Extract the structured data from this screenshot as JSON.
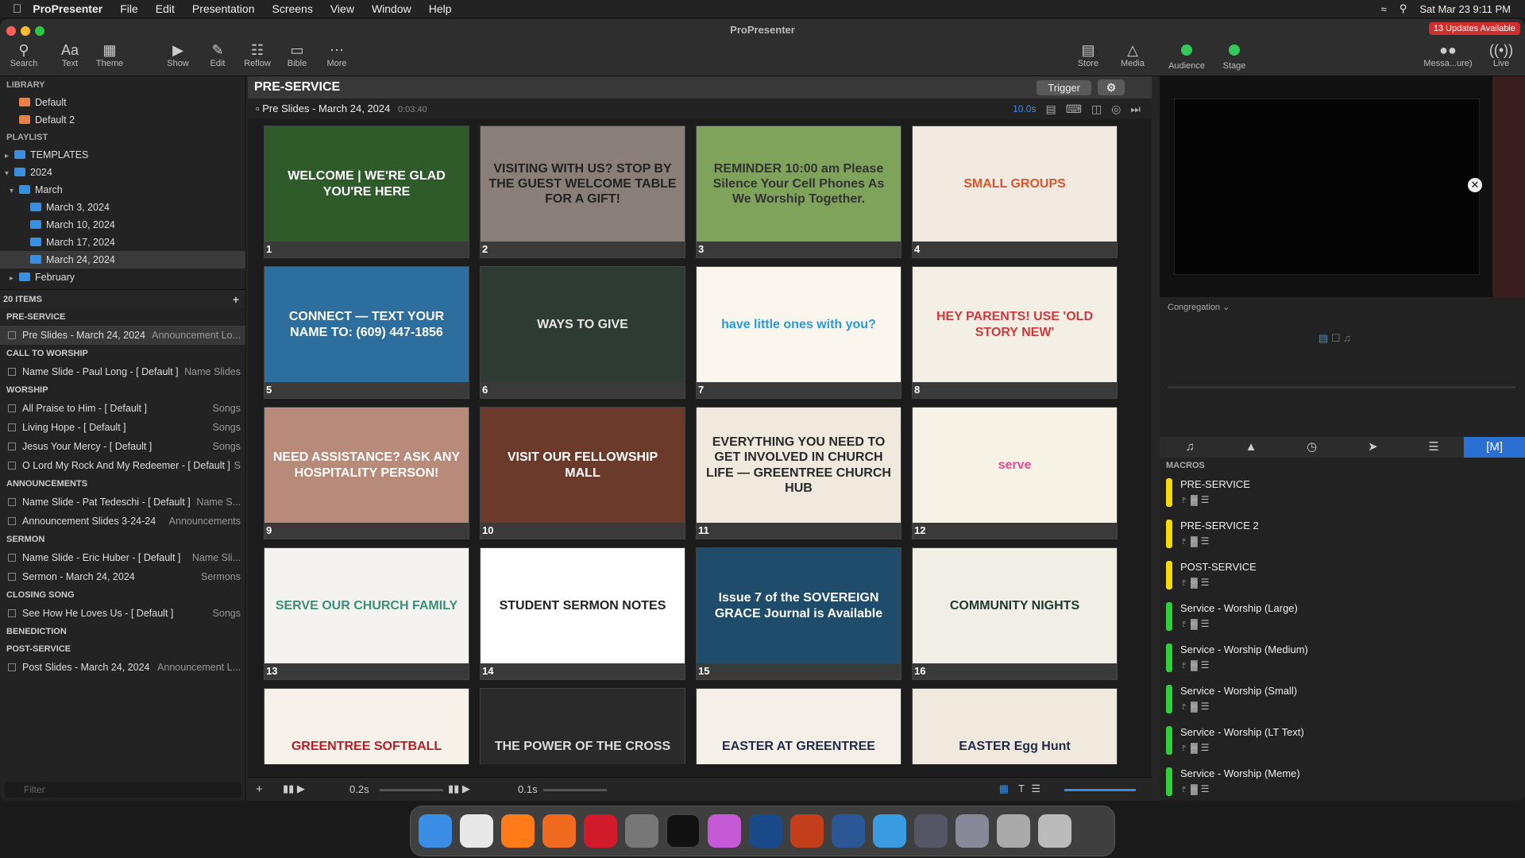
{
  "menubar": {
    "app": "ProPresenter",
    "items": [
      "File",
      "Edit",
      "Presentation",
      "Screens",
      "View",
      "Window",
      "Help"
    ],
    "clock": "Sat Mar 23  9:11 PM"
  },
  "window": {
    "title": "ProPresenter",
    "updates": "13 Updates Available"
  },
  "toolbar": {
    "search": "Search",
    "text": "Text",
    "theme": "Theme",
    "show": "Show",
    "edit": "Edit",
    "reflow": "Reflow",
    "bible": "Bible",
    "more": "More",
    "store": "Store",
    "media": "Media",
    "audience": "Audience",
    "stage": "Stage",
    "messages": "Messa...ure)",
    "live": "Live"
  },
  "library": {
    "heading": "LIBRARY",
    "items": [
      "Default",
      "Default 2"
    ],
    "playlist_heading": "PLAYLIST",
    "tree": [
      "TEMPLATES",
      "2024",
      "March",
      "March 3, 2024",
      "March 10, 2024",
      "March 17, 2024",
      "March 24, 2024",
      "February"
    ]
  },
  "playlist": {
    "count": "20 ITEMS",
    "rows": [
      {
        "kind": "header",
        "name": "PRE-SERVICE"
      },
      {
        "kind": "item",
        "name": "Pre Slides - March 24, 2024",
        "type": "Announcement Lo..."
      },
      {
        "kind": "header",
        "name": "CALL TO WORSHIP"
      },
      {
        "kind": "item",
        "name": "Name Slide - Paul Long - [ Default ]",
        "type": "Name Slides"
      },
      {
        "kind": "header",
        "name": "WORSHIP"
      },
      {
        "kind": "item",
        "name": "All Praise to Him - [ Default ]",
        "type": "Songs"
      },
      {
        "kind": "item",
        "name": "Living Hope - [ Default ]",
        "type": "Songs"
      },
      {
        "kind": "item",
        "name": "Jesus Your Mercy - [ Default ]",
        "type": "Songs"
      },
      {
        "kind": "item",
        "name": "O Lord My Rock And My Redeemer - [ Default ]",
        "type": "S"
      },
      {
        "kind": "header",
        "name": "ANNOUNCEMENTS"
      },
      {
        "kind": "item",
        "name": "Name Slide - Pat Tedeschi - [ Default ]",
        "type": "Name S..."
      },
      {
        "kind": "item",
        "name": "Announcement Slides 3-24-24",
        "type": "Announcements"
      },
      {
        "kind": "header",
        "name": "SERMON"
      },
      {
        "kind": "item",
        "name": "Name Slide - Eric Huber - [ Default ]",
        "type": "Name Sli..."
      },
      {
        "kind": "item",
        "name": "Sermon - March 24, 2024",
        "type": "Sermons"
      },
      {
        "kind": "header",
        "name": "CLOSING SONG"
      },
      {
        "kind": "item",
        "name": "See How He Loves Us - [ Default ]",
        "type": "Songs"
      },
      {
        "kind": "header",
        "name": "BENEDICTION"
      },
      {
        "kind": "header",
        "name": "POST-SERVICE"
      },
      {
        "kind": "item",
        "name": "Post Slides - March 24, 2024",
        "type": "Announcement L..."
      }
    ],
    "filter_placeholder": "Filter"
  },
  "presentation": {
    "header": "PRE-SERVICE",
    "trigger": "Trigger",
    "title": "Pre Slides - March 24, 2024",
    "duration": "0:03:40",
    "timer": "10.0s",
    "slides": [
      {
        "num": "1",
        "text": "WELCOME | WE'RE GLAD YOU'RE HERE",
        "bg": "#2f5a2a",
        "fg": "#ffffff"
      },
      {
        "num": "2",
        "text": "VISITING WITH US? STOP BY THE GUEST WELCOME TABLE FOR A GIFT!",
        "bg": "#8a7f78",
        "fg": "#222222"
      },
      {
        "num": "3",
        "text": "REMINDER 10:00 am Please Silence Your Cell Phones As We Worship Together.",
        "bg": "#7fa35b",
        "fg": "#333333"
      },
      {
        "num": "4",
        "text": "SMALL GROUPS",
        "bg": "#f2e9e0",
        "fg": "#d9572b"
      },
      {
        "num": "5",
        "text": "CONNECT — TEXT YOUR NAME TO: (609) 447-1856",
        "bg": "#2c6f9e",
        "fg": "#ffffff"
      },
      {
        "num": "6",
        "text": "WAYS TO GIVE",
        "bg": "#2e3a34",
        "fg": "#e6e6e6"
      },
      {
        "num": "7",
        "text": "have little ones with you?",
        "bg": "#faf6ee",
        "fg": "#2a9bd6"
      },
      {
        "num": "8",
        "text": "HEY PARENTS! USE 'OLD STORY NEW'",
        "bg": "#f4efe4",
        "fg": "#d1393f"
      },
      {
        "num": "9",
        "text": "NEED ASSISTANCE? ASK ANY HOSPITALITY PERSON!",
        "bg": "#b88a7a",
        "fg": "#ffffff"
      },
      {
        "num": "10",
        "text": "VISIT OUR FELLOWSHIP MALL",
        "bg": "#6b3a2a",
        "fg": "#ffffff"
      },
      {
        "num": "11",
        "text": "EVERYTHING YOU NEED TO GET INVOLVED IN CHURCH LIFE — GREENTREE CHURCH HUB",
        "bg": "#efe9de",
        "fg": "#2a2a2a"
      },
      {
        "num": "12",
        "text": "serve",
        "bg": "#f7f2e6",
        "fg": "#e84a8f"
      },
      {
        "num": "13",
        "text": "SERVE OUR CHURCH FAMILY",
        "bg": "#f5f3ef",
        "fg": "#3b8f77"
      },
      {
        "num": "14",
        "text": "STUDENT SERMON NOTES",
        "bg": "#ffffff",
        "fg": "#222222"
      },
      {
        "num": "15",
        "text": "Issue 7 of the SOVEREIGN GRACE Journal is Available",
        "bg": "#1f4c6b",
        "fg": "#ffffff"
      },
      {
        "num": "16",
        "text": "COMMUNITY NIGHTS",
        "bg": "#f1eee6",
        "fg": "#1f3a2e"
      },
      {
        "num": "",
        "text": "GREENTREE SOFTBALL",
        "bg": "#f6f2ea",
        "fg": "#b3202a"
      },
      {
        "num": "",
        "text": "THE POWER OF THE CROSS",
        "bg": "#2a2a2a",
        "fg": "#dddddd"
      },
      {
        "num": "",
        "text": "EASTER AT GREENTREE",
        "bg": "#f4f0e8",
        "fg": "#1f2a4a"
      },
      {
        "num": "",
        "text": "EASTER Egg Hunt",
        "bg": "#f0e9dd",
        "fg": "#1f2a4a"
      }
    ],
    "footer": {
      "transition1": "0.2s",
      "transition2": "0.1s"
    }
  },
  "rightpanel": {
    "screen": "Congregation",
    "macros_heading": "MACROS",
    "macros": [
      {
        "name": "PRE-SERVICE",
        "color": "#f5d90a"
      },
      {
        "name": "PRE-SERVICE 2",
        "color": "#f5d90a"
      },
      {
        "name": "POST-SERVICE",
        "color": "#f5d90a"
      },
      {
        "name": "Service - Worship (Large)",
        "color": "#2fcf3b"
      },
      {
        "name": "Service - Worship (Medium)",
        "color": "#2fcf3b"
      },
      {
        "name": "Service - Worship (Small)",
        "color": "#2fcf3b"
      },
      {
        "name": "Service - Worship (LT Text)",
        "color": "#2fcf3b"
      },
      {
        "name": "Service - Worship (Meme)",
        "color": "#2fcf3b"
      }
    ]
  }
}
